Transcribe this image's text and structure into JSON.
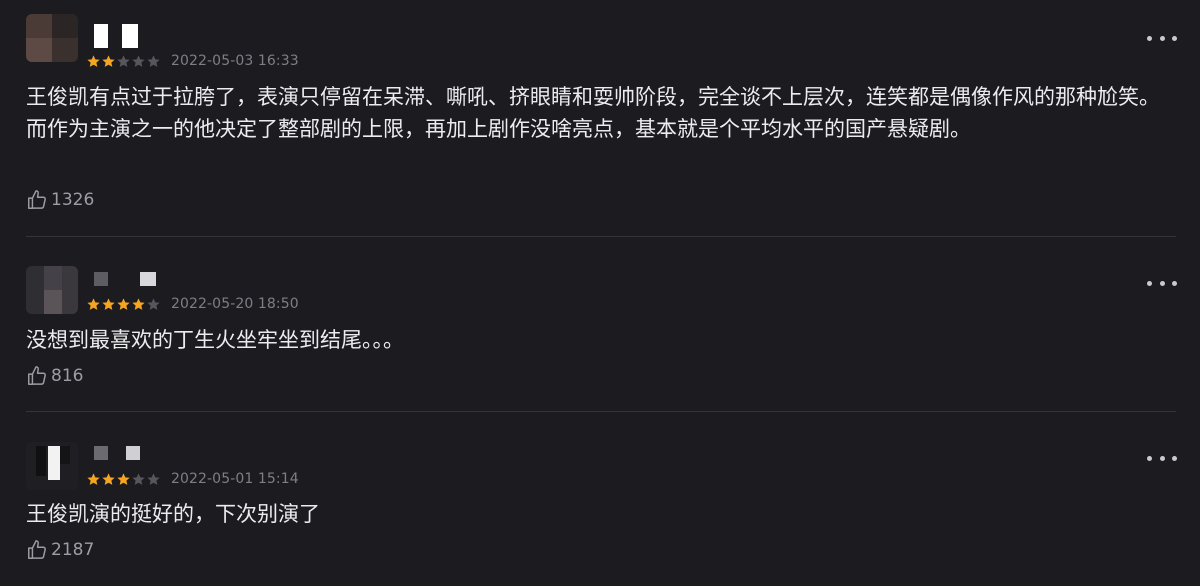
{
  "reviews": [
    {
      "rating": 2,
      "max_rating": 5,
      "date": "2022-05-03 16:33",
      "text": "王俊凯有点过于拉胯了，表演只停留在呆滞、嘶吼、挤眼睛和耍帅阶段，完全谈不上层次，连笑都是偶像作风的那种尬笑。而作为主演之一的他决定了整部剧的上限，再加上剧作没啥亮点，基本就是个平均水平的国产悬疑剧。",
      "likes": "1326"
    },
    {
      "rating": 4,
      "max_rating": 5,
      "date": "2022-05-20 18:50",
      "text": "没想到最喜欢的丁生火坐牢坐到结尾。。。",
      "likes": "816"
    },
    {
      "rating": 3,
      "max_rating": 5,
      "date": "2022-05-01 15:14",
      "text": "王俊凯演的挺好的，下次别演了",
      "likes": "2187"
    }
  ],
  "colors": {
    "background": "#1c1b20",
    "star_filled": "#f4a521",
    "star_empty": "#56565c",
    "date": "#7e7e85",
    "text": "#ececee",
    "divider": "#34333a"
  },
  "icons": {
    "like": "thumbs-up-icon",
    "more": "more-dots-icon",
    "star": "star-icon"
  }
}
